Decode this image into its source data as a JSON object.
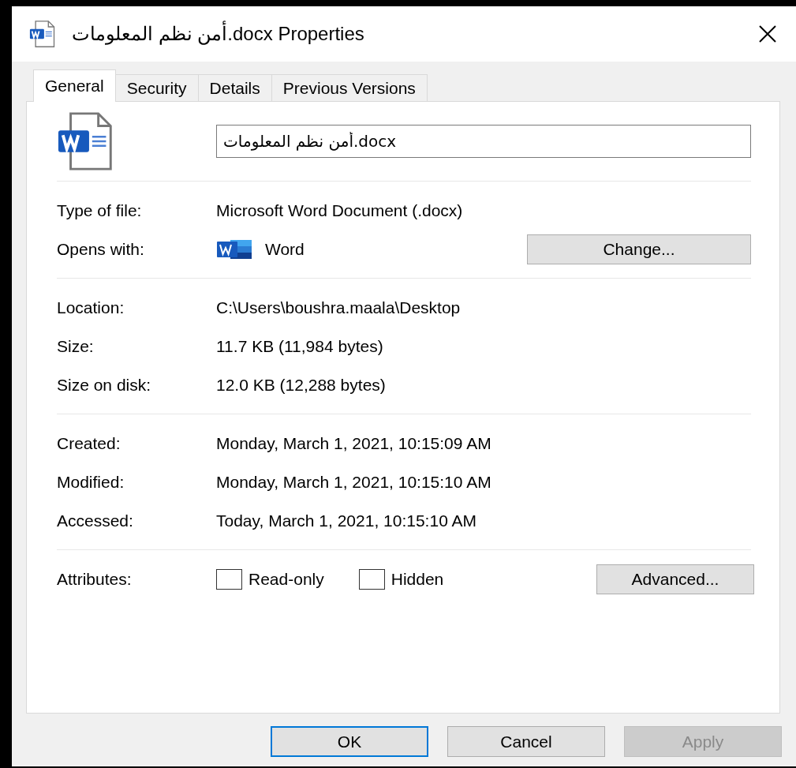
{
  "window": {
    "title": "أمن نظم المعلومات.docx Properties"
  },
  "tabs": [
    {
      "label": "General",
      "selected": true
    },
    {
      "label": "Security",
      "selected": false
    },
    {
      "label": "Details",
      "selected": false
    },
    {
      "label": "Previous Versions",
      "selected": false
    }
  ],
  "file_name": {
    "value": "أمن نظم المعلومات.docx"
  },
  "sections": [
    [
      {
        "kind": "text",
        "label": "Type of file:",
        "value": "Microsoft Word Document (.docx)"
      },
      {
        "kind": "app",
        "label": "Opens with:",
        "value": "Word",
        "button": "Change..."
      }
    ],
    [
      {
        "kind": "text",
        "label": "Location:",
        "value": "C:\\Users\\boushra.maala\\Desktop"
      },
      {
        "kind": "text",
        "label": "Size:",
        "value": "11.7 KB (11,984 bytes)"
      },
      {
        "kind": "text",
        "label": "Size on disk:",
        "value": "12.0 KB (12,288 bytes)"
      }
    ],
    [
      {
        "kind": "text",
        "label": "Created:",
        "value": "Monday, March 1, 2021, 10:15:09 AM"
      },
      {
        "kind": "text",
        "label": "Modified:",
        "value": "Monday, March 1, 2021, 10:15:10 AM"
      },
      {
        "kind": "text",
        "label": "Accessed:",
        "value": "Today, March 1, 2021, 10:15:10 AM"
      }
    ],
    [
      {
        "kind": "attributes",
        "label": "Attributes:",
        "checkboxes": [
          {
            "label": "Read-only",
            "checked": false
          },
          {
            "label": "Hidden",
            "checked": false
          }
        ],
        "button": "Advanced..."
      }
    ]
  ],
  "buttons": [
    {
      "label": "OK",
      "default": true,
      "disabled": false
    },
    {
      "label": "Cancel",
      "default": false,
      "disabled": false
    },
    {
      "label": "Apply",
      "default": false,
      "disabled": true
    }
  ]
}
